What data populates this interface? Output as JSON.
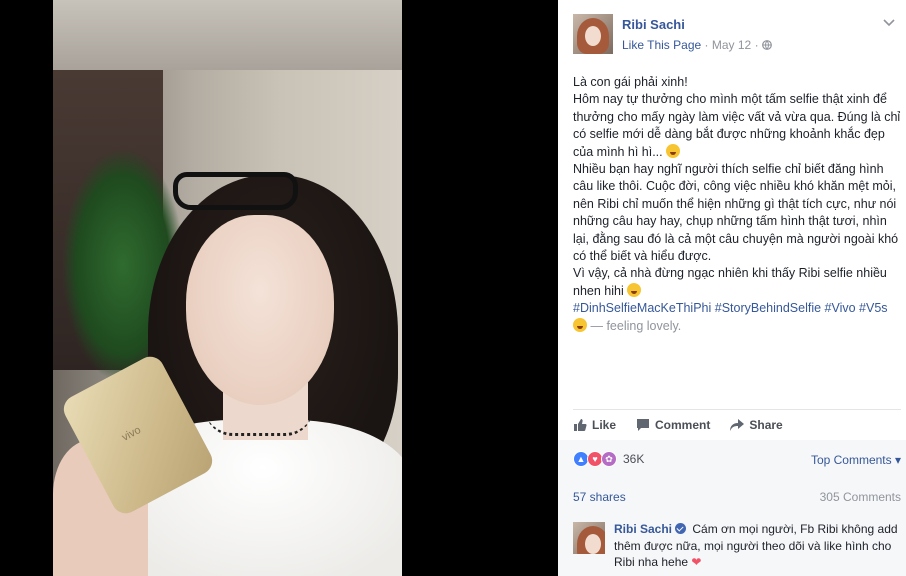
{
  "post": {
    "author": "Ribi Sachi",
    "like_page": "Like This Page",
    "date": "May 12",
    "text_lines": [
      "Là con gái phải xinh!",
      "Hôm nay tự thưởng cho mình một tấm selfie thật xinh để thưởng cho mấy ngày làm việc vất vả vừa qua. Đúng là chỉ có selfie mới dễ dàng bắt được những khoảnh khắc đẹp của mình hì hì...",
      "Nhiều bạn hay nghĩ người thích selfie chỉ biết đăng hình câu like thôi. Cuộc đời, công việc nhiều khó khăn mệt mỏi, nên Ribi chỉ muốn thể hiện những gì thật tích cực, như nói những câu hay hay, chụp những tấm hình thật tươi, nhìn lại, đằng sau đó là cả một câu chuyện mà người ngoài khó có thể biết và hiểu được.",
      "Vì vậy, cả nhà đừng ngạc nhiên khi thấy Ribi selfie nhiều nhen hihi"
    ],
    "hashtags": "#DinhSelfieMacKeThiPhi #StoryBehindSelfie #Vivo #V5s",
    "feeling": "— feeling lovely.",
    "photo_phone_brand": "vivo"
  },
  "actions": {
    "like": "Like",
    "comment": "Comment",
    "share": "Share"
  },
  "stats": {
    "reactions_count": "36K",
    "top_comments": "Top Comments ▾",
    "shares": "57 shares",
    "comments": "305 Comments"
  },
  "comment": {
    "author": "Ribi Sachi",
    "text": "Cám ơn mọi người, Fb Ribi không add thêm được nữa, mọi người theo dõi và like hình cho Ribi nha hehe"
  },
  "colors": {
    "link": "#365899",
    "muted": "#90949c",
    "like_reaction": "#4080ff",
    "love_reaction": "#f25268"
  }
}
